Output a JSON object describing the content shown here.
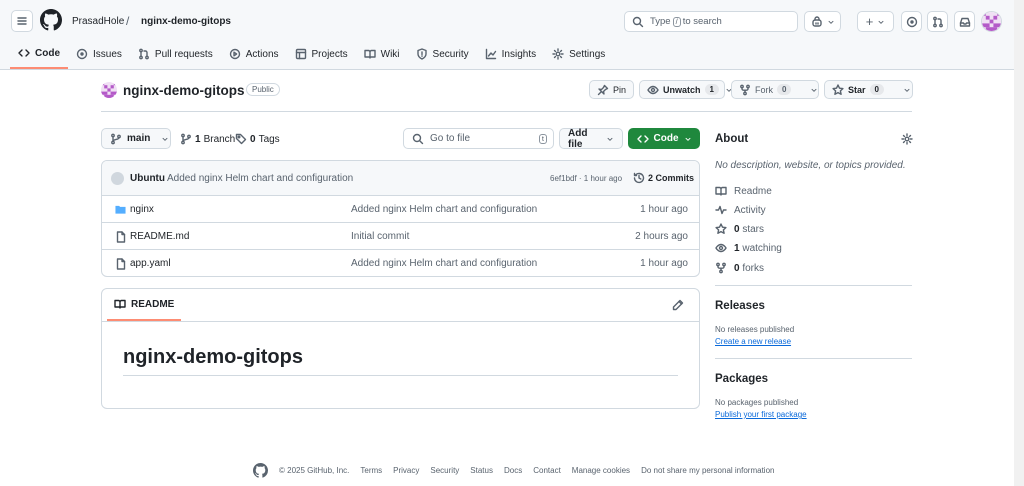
{
  "header": {
    "owner": "PrasadHole",
    "separator": "/",
    "repo": "nginx-demo-gitops",
    "search_placeholder_pre": "Type",
    "search_key": "/",
    "search_placeholder_post": "to search",
    "plus_label": "+"
  },
  "tabs": [
    {
      "label": "Code",
      "icon": "code-icon"
    },
    {
      "label": "Issues",
      "icon": "issue-icon"
    },
    {
      "label": "Pull requests",
      "icon": "pull-request-icon"
    },
    {
      "label": "Actions",
      "icon": "play-icon"
    },
    {
      "label": "Projects",
      "icon": "table-icon"
    },
    {
      "label": "Wiki",
      "icon": "book-icon"
    },
    {
      "label": "Security",
      "icon": "shield-icon"
    },
    {
      "label": "Insights",
      "icon": "graph-icon"
    },
    {
      "label": "Settings",
      "icon": "gear-icon"
    }
  ],
  "repo": {
    "name": "nginx-demo-gitops",
    "visibility": "Public",
    "pin_label": "Pin",
    "unwatch_label": "Unwatch",
    "watch_count": "1",
    "fork_label": "Fork",
    "fork_count": "0",
    "star_label": "Star",
    "star_count": "0"
  },
  "toolbar": {
    "branch": "main",
    "branches_count": "1",
    "branches_label": "Branch",
    "tags_count": "0",
    "tags_label": "Tags",
    "go_to_file": "Go to file",
    "go_to_file_key": "t",
    "add_file": "Add file",
    "code": "Code"
  },
  "commit": {
    "author": "Ubuntu",
    "message": "Added nginx Helm chart and configuration",
    "hash_time": "6ef1bdf · 1 hour ago",
    "commits": "2 Commits"
  },
  "files": [
    {
      "name": "nginx",
      "type": "folder",
      "message": "Added nginx Helm chart and configuration",
      "time": "1 hour ago"
    },
    {
      "name": "README.md",
      "type": "file",
      "message": "Initial commit",
      "time": "2 hours ago"
    },
    {
      "name": "app.yaml",
      "type": "file",
      "message": "Added nginx Helm chart and configuration",
      "time": "1 hour ago"
    }
  ],
  "readme": {
    "tab": "README",
    "heading": "nginx-demo-gitops"
  },
  "about": {
    "title": "About",
    "description": "No description, website, or topics provided.",
    "readme": "Readme",
    "activity": "Activity",
    "stars_count": "0",
    "stars_label": "stars",
    "watching_count": "1",
    "watching_label": "watching",
    "forks_count": "0",
    "forks_label": "forks"
  },
  "releases": {
    "title": "Releases",
    "empty": "No releases published",
    "link": "Create a new release"
  },
  "packages": {
    "title": "Packages",
    "empty": "No packages published",
    "link": "Publish your first package"
  },
  "footer": {
    "copyright": "© 2025 GitHub, Inc.",
    "links": [
      "Terms",
      "Privacy",
      "Security",
      "Status",
      "Docs",
      "Contact",
      "Manage cookies",
      "Do not share my personal information"
    ]
  },
  "colors": {
    "accent_green": "#1f883d",
    "link_blue": "#0969da",
    "tab_underline": "#fd8c73",
    "folder_blue": "#54aeff"
  }
}
